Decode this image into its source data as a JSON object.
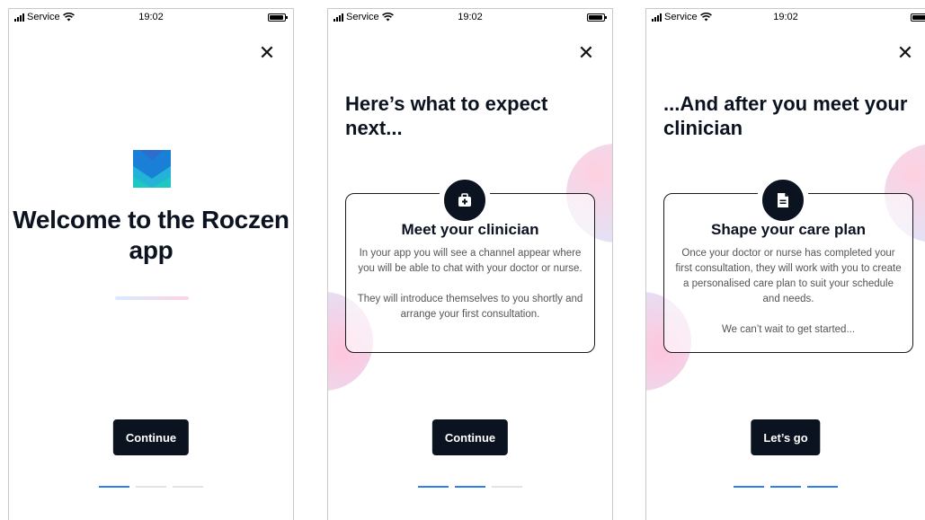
{
  "status_bar": {
    "carrier": "Service",
    "time": "19:02"
  },
  "screen1": {
    "title": "Welcome to the Roczen app",
    "button_label": "Continue",
    "pager": [
      true,
      false,
      false
    ]
  },
  "screen2": {
    "heading": "Here’s what to expect next...",
    "card_icon": "medical-kit-icon",
    "card_title": "Meet your clinician",
    "card_p1": "In your app you will see a channel appear where you will be able to chat with your doctor or nurse.",
    "card_p2": "They will introduce themselves to you shortly and arrange your first consultation.",
    "button_label": "Continue",
    "pager": [
      true,
      true,
      false
    ]
  },
  "screen3": {
    "heading": "...And after you meet your clinician",
    "card_icon": "document-icon",
    "card_title": "Shape your care plan",
    "card_p1": "Once your doctor or nurse has completed your first consultation, they will work with you to create a personalised care plan to suit your schedule and needs.",
    "card_p2": "We can’t wait to get started...",
    "button_label": "Let’s go",
    "pager": [
      true,
      true,
      true
    ]
  },
  "colors": {
    "primary": "#0b1220",
    "pager_active": "#2f80ed",
    "pager_inactive": "#e4e4e4"
  }
}
